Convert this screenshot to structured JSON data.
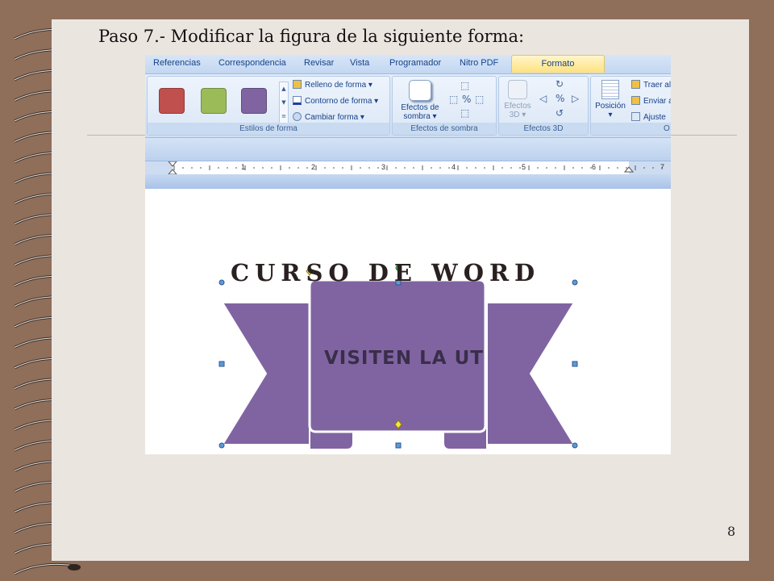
{
  "slide": {
    "title": "Paso 7.- Modificar la figura de la siguiente forma:",
    "page_number": "8"
  },
  "ribbon": {
    "tabs": [
      {
        "label": "Referencias"
      },
      {
        "label": "Correspondencia"
      },
      {
        "label": "Revisar"
      },
      {
        "label": "Vista"
      },
      {
        "label": "Programador"
      },
      {
        "label": "Nitro PDF"
      },
      {
        "label": "Formato",
        "active": true
      }
    ],
    "shape_styles": {
      "group_label": "Estilos de forma",
      "swatch_colors": [
        "#c0504d",
        "#9bbb59",
        "#8064a2"
      ],
      "fill_label": "Relleno de forma",
      "outline_label": "Contorno de forma",
      "change_label": "Cambiar forma"
    },
    "shadow_effects": {
      "group_label": "Efectos de sombra",
      "button_label_line1": "Efectos de",
      "button_label_line2": "sombra"
    },
    "effects_3d": {
      "group_label": "Efectos 3D",
      "button_label_line1": "Efectos",
      "button_label_line2": "3D"
    },
    "arrange": {
      "group_label": "O",
      "position_label": "Posición",
      "bring_label": "Traer al",
      "send_label": "Enviar a",
      "wrap_label": "Ajuste"
    }
  },
  "ruler": {
    "numbers": [
      "1",
      "2",
      "3",
      "4",
      "5",
      "6",
      "7"
    ]
  },
  "document": {
    "heading": "CURSO DE WORD",
    "banner_text": "VISITEN LA UT",
    "banner_color": "#8064a2"
  }
}
